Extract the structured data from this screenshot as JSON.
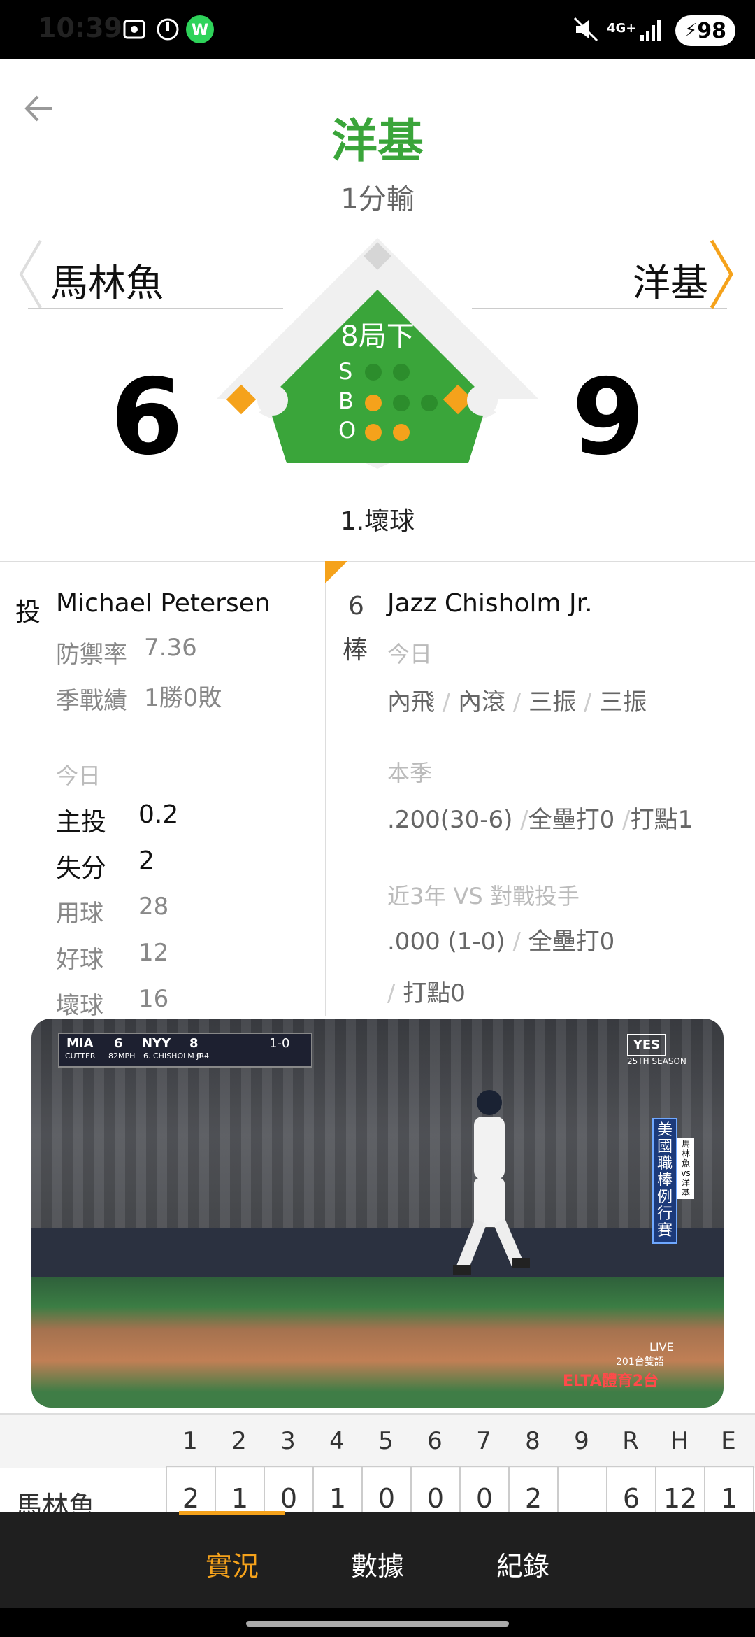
{
  "status_bar": {
    "time": "10:39",
    "battery": "98",
    "network": "4G+"
  },
  "header": {
    "title": "洋基",
    "subtitle": "1分輸"
  },
  "teams": {
    "away": "馬林魚",
    "home": "洋基",
    "away_score": "6",
    "home_score": "9"
  },
  "game_state": {
    "inning": "8局下",
    "s_label": "S",
    "b_label": "B",
    "o_label": "O",
    "strikes": 0,
    "balls": 1,
    "outs": 2,
    "play": "1.壞球"
  },
  "pitcher": {
    "pos_label": "投",
    "name": "Michael Petersen",
    "era_label": "防禦率",
    "era": "7.36",
    "record_label": "季戰績",
    "record": "1勝0敗",
    "today_label": "今日",
    "stats": [
      {
        "label": "主投",
        "value": "0.2"
      },
      {
        "label": "失分",
        "value": "2"
      },
      {
        "label": "用球",
        "value": "28"
      },
      {
        "label": "好球",
        "value": "12"
      },
      {
        "label": "壞球",
        "value": "16"
      }
    ]
  },
  "batter": {
    "order": "6",
    "order_label": "棒",
    "name": "Jazz Chisholm Jr.",
    "today_label": "今日",
    "today_results": [
      "內飛",
      "內滾",
      "三振",
      "三振"
    ],
    "season_label": "本季",
    "season_avg": ".200(30-6)",
    "season_hr": "全壘打0",
    "season_rbi": "打點1",
    "vs_label": "近3年 VS 對戰投手",
    "vs_avg": ".000 (1-0)",
    "vs_hr": "全壘打0",
    "vs_rbi": "打點0"
  },
  "video": {
    "scorebug_away": "MIA",
    "scorebug_away_score": "6",
    "scorebug_home": "NYY",
    "scorebug_home_score": "8",
    "scorebug_count": "1-0",
    "scorebug_pitch": "CUTTER",
    "scorebug_speed": "82MPH",
    "scorebug_batter": "6. CHISHOLM JR.",
    "scorebug_batter_stat": "0-4",
    "network_logo": "YES",
    "season_text": "25TH SEASON",
    "side_banner": "美國職棒例行賽",
    "side_matchup": "馬林魚 vs 洋基",
    "live_text": "LIVE",
    "channel_text": "201台雙語",
    "channel_logo": "ELTA體育2台"
  },
  "line_score": {
    "headers": [
      "1",
      "2",
      "3",
      "4",
      "5",
      "6",
      "7",
      "8",
      "9",
      "R",
      "H",
      "E"
    ],
    "row_team": "馬林魚",
    "row_values": [
      "2",
      "1",
      "0",
      "1",
      "0",
      "0",
      "0",
      "2",
      "",
      "6",
      "12",
      "1"
    ]
  },
  "bottom_nav": {
    "tabs": [
      "實況",
      "數據",
      "紀錄"
    ],
    "active": 0
  },
  "colors": {
    "accent": "#f5a21b",
    "green": "#3aa53a",
    "field": "#3aa53a"
  }
}
